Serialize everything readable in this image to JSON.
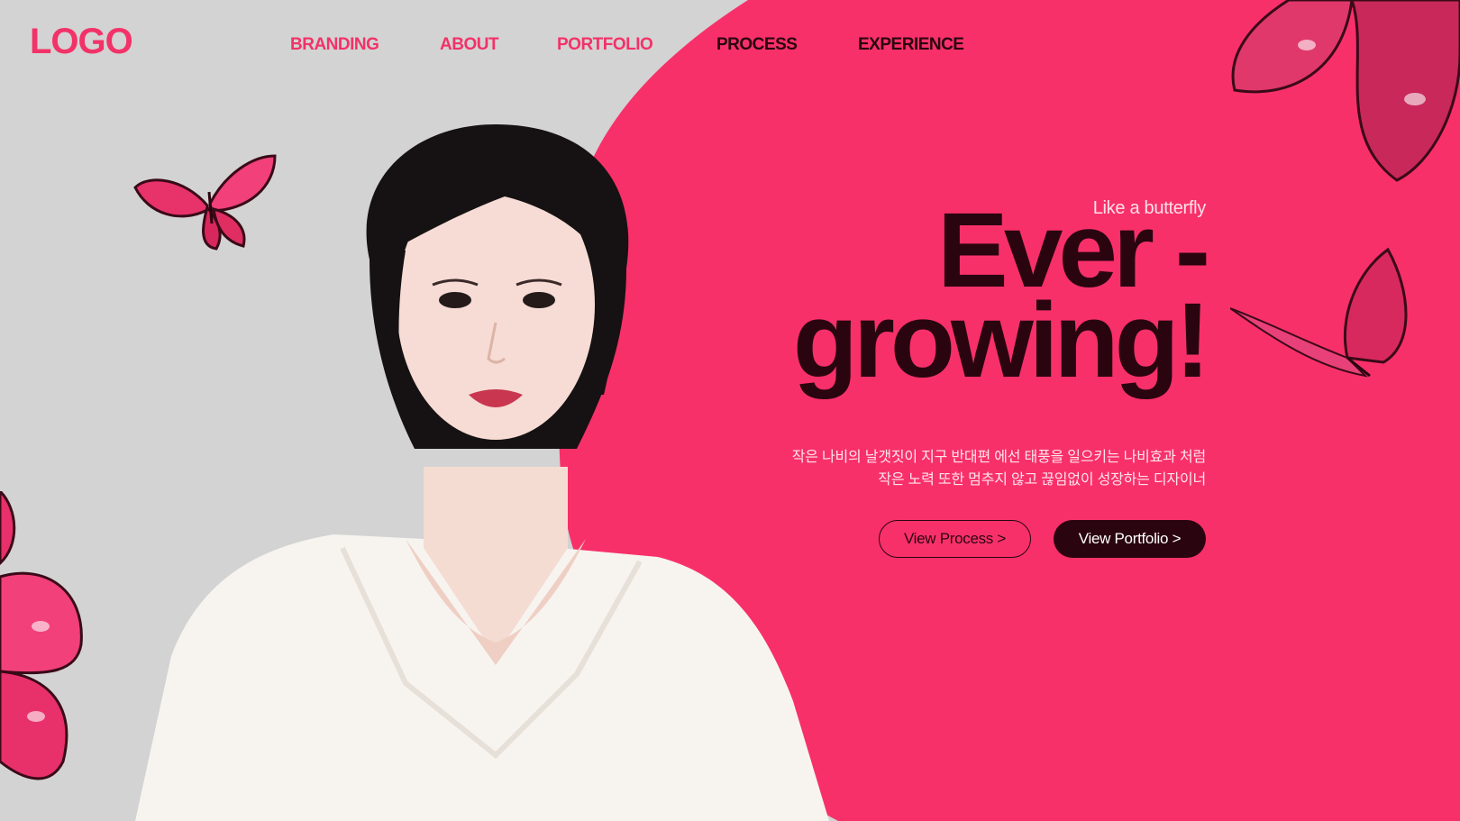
{
  "logo": "LOGO",
  "nav": {
    "items": [
      {
        "label": "BRANDING"
      },
      {
        "label": "ABOUT"
      },
      {
        "label": "PORTFOLIO"
      },
      {
        "label": "PROCESS"
      },
      {
        "label": "EXPERIENCE"
      }
    ]
  },
  "hero": {
    "tagline": "Like a butterfly",
    "headline_line1": "Ever -",
    "headline_line2": "growing!",
    "description_line1": "작은 나비의 날갯짓이 지구 반대편 에선 태풍을 일으키는 나비효과 처럼",
    "description_line2": "작은 노력 또한 멈추지 않고 끊임없이 성장하는 디자이너"
  },
  "buttons": {
    "process": "View Process >",
    "portfolio": "View Portfolio >"
  },
  "colors": {
    "accent_pink": "#f8306a",
    "logo_pink": "#f23268",
    "dark": "#2a0510",
    "background_gray": "#d3d3d3"
  }
}
